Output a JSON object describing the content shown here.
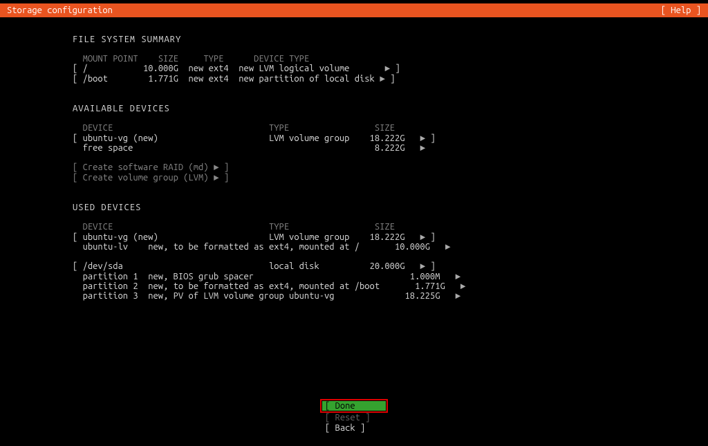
{
  "titlebar": {
    "title": "Storage configuration",
    "help": "[ Help ]"
  },
  "fs_summary": {
    "heading": "FILE SYSTEM SUMMARY",
    "cols": {
      "mount": "MOUNT POINT",
      "size": "SIZE",
      "type": "TYPE",
      "dtype": "DEVICE TYPE"
    },
    "rows": [
      {
        "mount": "/",
        "size": "10.000G",
        "type": "new ext4",
        "dtype": "new LVM logical volume"
      },
      {
        "mount": "/boot",
        "size": "1.771G",
        "type": "new ext4",
        "dtype": "new partition of local disk"
      }
    ]
  },
  "avail": {
    "heading": "AVAILABLE DEVICES",
    "cols": {
      "device": "DEVICE",
      "type": "TYPE",
      "size": "SIZE"
    },
    "rows": [
      {
        "device": "ubuntu-vg (new)",
        "type": "LVM volume group",
        "size": "18.222G",
        "bracket": true
      },
      {
        "device": "free space",
        "type": "",
        "size": "8.222G",
        "bracket": false
      }
    ],
    "actions": {
      "raid": "Create software RAID (md) ►",
      "lvm": "Create volume group (LVM) ►"
    }
  },
  "used": {
    "heading": "USED DEVICES",
    "cols": {
      "device": "DEVICE",
      "type": "TYPE",
      "size": "SIZE"
    },
    "group1": {
      "head": {
        "device": "ubuntu-vg (new)",
        "type": "LVM volume group",
        "size": "18.222G"
      },
      "children": [
        {
          "name": "ubuntu-lv",
          "desc": "new, to be formatted as ext4, mounted at /",
          "size": "10.000G"
        }
      ]
    },
    "group2": {
      "head": {
        "device": "/dev/sda",
        "type": "local disk",
        "size": "20.000G"
      },
      "children": [
        {
          "name": "partition 1",
          "desc": "new, BIOS grub spacer",
          "size": "1.000M"
        },
        {
          "name": "partition 2",
          "desc": "new, to be formatted as ext4, mounted at /boot",
          "size": "1.771G"
        },
        {
          "name": "partition 3",
          "desc": "new, PV of LVM volume group ubuntu-vg",
          "size": "18.225G"
        }
      ]
    }
  },
  "footer": {
    "done": "Done",
    "reset": "Reset",
    "back": "Back"
  },
  "glyph": {
    "arrow": "►"
  }
}
